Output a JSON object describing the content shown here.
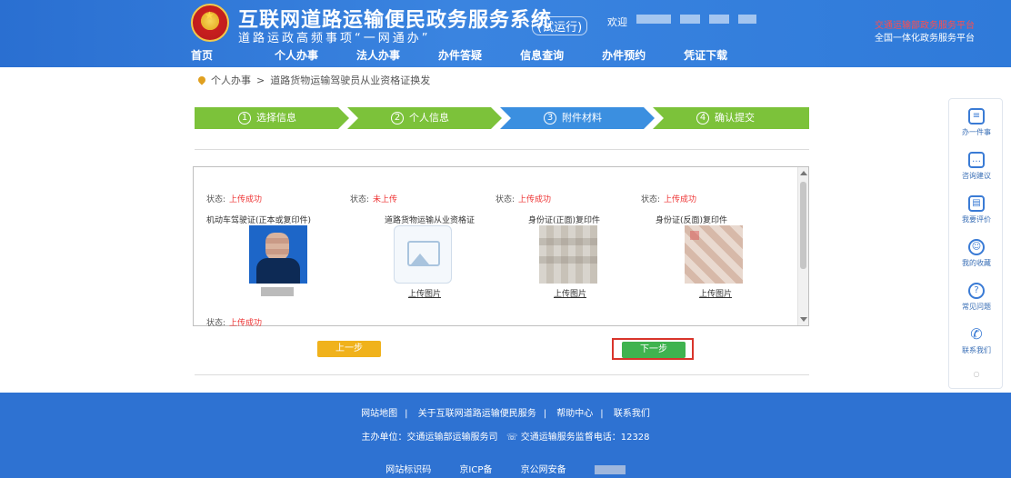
{
  "header": {
    "title": "互联网道路运输便民政务服务系统",
    "trial": "(试运行)",
    "slogan": "道路运政高频事项“一网通办”",
    "user_label": "欢迎",
    "right_notice": "交通运输部政务服务平台",
    "right_notice2": "全国一体化政务服务平台"
  },
  "nav": [
    "首页",
    "个人办事",
    "法人办事",
    "办件答疑",
    "信息查询",
    "办件预约",
    "凭证下载"
  ],
  "breadcrumb": {
    "home": "个人办事",
    "current": "道路货物运输驾驶员从业资格证换发"
  },
  "steps": [
    {
      "num": "1",
      "label": "选择信息"
    },
    {
      "num": "2",
      "label": "个人信息"
    },
    {
      "num": "3",
      "label": "附件材料"
    },
    {
      "num": "4",
      "label": "确认提交"
    }
  ],
  "colors": {
    "done": "#7cc23a",
    "active": "#3b8fe0",
    "header": "#2a6fd1"
  },
  "uploads": [
    {
      "status_label": "状态:",
      "status": "上传成功",
      "title": "机动车驾驶证(正本或复印件)",
      "caption": "",
      "thumb": "portrait"
    },
    {
      "status_label": "状态:",
      "status": "未上传",
      "title": "道路货物运输从业资格证",
      "caption": "上传图片",
      "thumb": "placeholder"
    },
    {
      "status_label": "状态:",
      "status": "上传成功",
      "title": "身份证(正面)复印件",
      "caption": "上传图片",
      "thumb": "doc"
    },
    {
      "status_label": "状态:",
      "status": "上传成功",
      "title": "身份证(反面)复印件",
      "caption": "上传图片",
      "thumb": "cert"
    }
  ],
  "bottom_status": {
    "label": "状态:",
    "value": "上传成功"
  },
  "buttons": {
    "prev": "上一步",
    "next": "下一步"
  },
  "float_bar": [
    "办一件事",
    "咨询建议",
    "我要评价",
    "我的收藏",
    "常见问题",
    "联系我们"
  ],
  "footer": {
    "links": [
      "网站地图",
      "关于互联网道路运输便民服务",
      "帮助中心",
      "联系我们"
    ],
    "line2_left": "主办单位：交通运输部运输服务司",
    "line2_right": "交通运输服务监督电话：12328",
    "line3": [
      "网站标识码",
      "京ICP备",
      "京公网安备"
    ]
  }
}
